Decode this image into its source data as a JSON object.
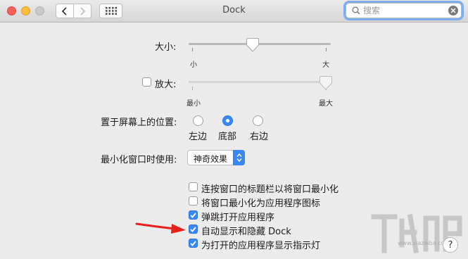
{
  "window": {
    "title": "Dock"
  },
  "search": {
    "placeholder": "搜索"
  },
  "size": {
    "label": "大小:",
    "min_label": "小",
    "max_label": "大",
    "value": 0.45
  },
  "magnification": {
    "label": "放大:",
    "checked": false,
    "min_label": "最小",
    "max_label": "最大",
    "value": 1.0
  },
  "position": {
    "label": "置于屏幕上的位置:",
    "options": [
      {
        "label": "左边",
        "selected": false
      },
      {
        "label": "底部",
        "selected": true
      },
      {
        "label": "右边",
        "selected": false
      }
    ]
  },
  "minimize": {
    "label": "最小化窗口时使用:",
    "value": "神奇效果"
  },
  "checkboxes": [
    {
      "label": "连按窗口的标题栏以将窗口最小化",
      "checked": false
    },
    {
      "label": "将窗口最小化为应用程序图标",
      "checked": false
    },
    {
      "label": "弹跳打开应用程序",
      "checked": true
    },
    {
      "label": "自动显示和隐藏 Dock",
      "checked": true
    },
    {
      "label": "为打开的应用程序显示指示灯",
      "checked": true
    }
  ],
  "help": {
    "label": "?"
  },
  "watermark": {
    "url": "www.xiazaiba.com"
  },
  "colors": {
    "accent": "#3a88f5",
    "annotation_arrow": "#e8201c"
  }
}
